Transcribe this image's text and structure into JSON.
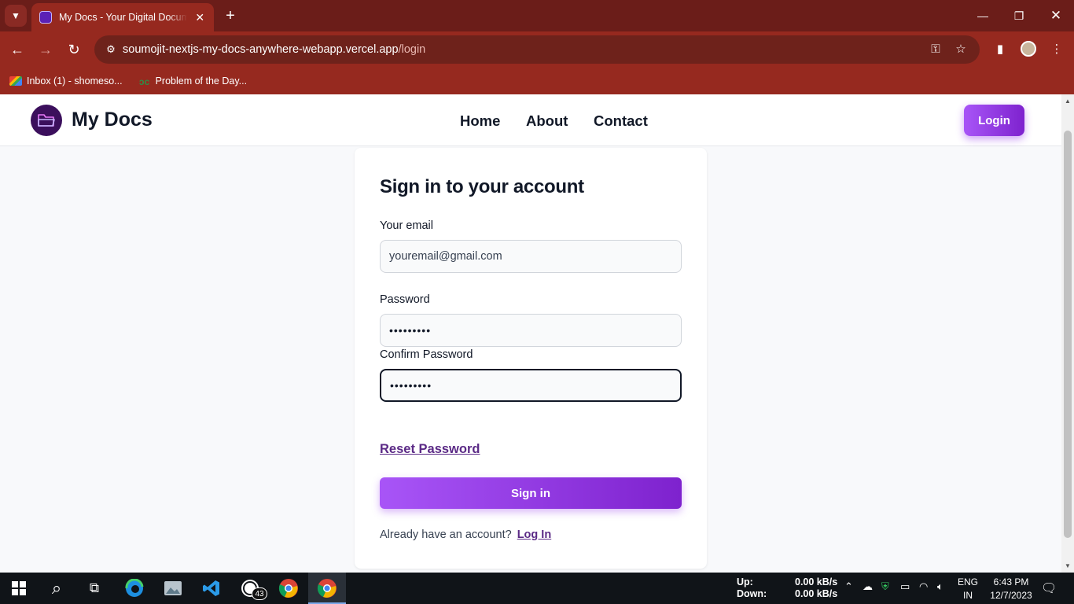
{
  "browser": {
    "tab_title": "My Docs - Your Digital Document Anywhere",
    "tab_close": "✕",
    "new_tab": "+",
    "url_host": "soumojit-nextjs-my-docs-anywhere-webapp.vercel.app",
    "url_path": "/login",
    "bookmarks": [
      {
        "label": "Inbox (1) - shomeso..."
      },
      {
        "label": "Problem of the Day..."
      }
    ]
  },
  "navbar": {
    "brand": "My Docs",
    "links": [
      "Home",
      "About",
      "Contact"
    ],
    "login_label": "Login"
  },
  "form": {
    "title": "Sign in to your account",
    "email_label": "Your email",
    "email_placeholder": "youremail@gmail.com",
    "password_label": "Password",
    "password_value": "•••••••••",
    "confirm_label": "Confirm Password",
    "confirm_value": "•••••••••",
    "reset_label": "Reset Password",
    "signin_label": "Sign in",
    "footer_text": "Already have an account?",
    "footer_link": "Log In"
  },
  "taskbar": {
    "whatsapp_badge": "43",
    "net_up_label": "Up:",
    "net_down_label": "Down:",
    "net_up_value": "0.00 kB/s",
    "net_down_value": "0.00 kB/s",
    "lang_1": "ENG",
    "lang_2": "IN",
    "time": "6:43 PM",
    "date": "12/7/2023"
  },
  "colors": {
    "chrome_dark": "#6b1d19",
    "chrome": "#96291f",
    "accent_start": "#a855f7",
    "accent_end": "#7e22ce",
    "link": "#5b2a86"
  }
}
